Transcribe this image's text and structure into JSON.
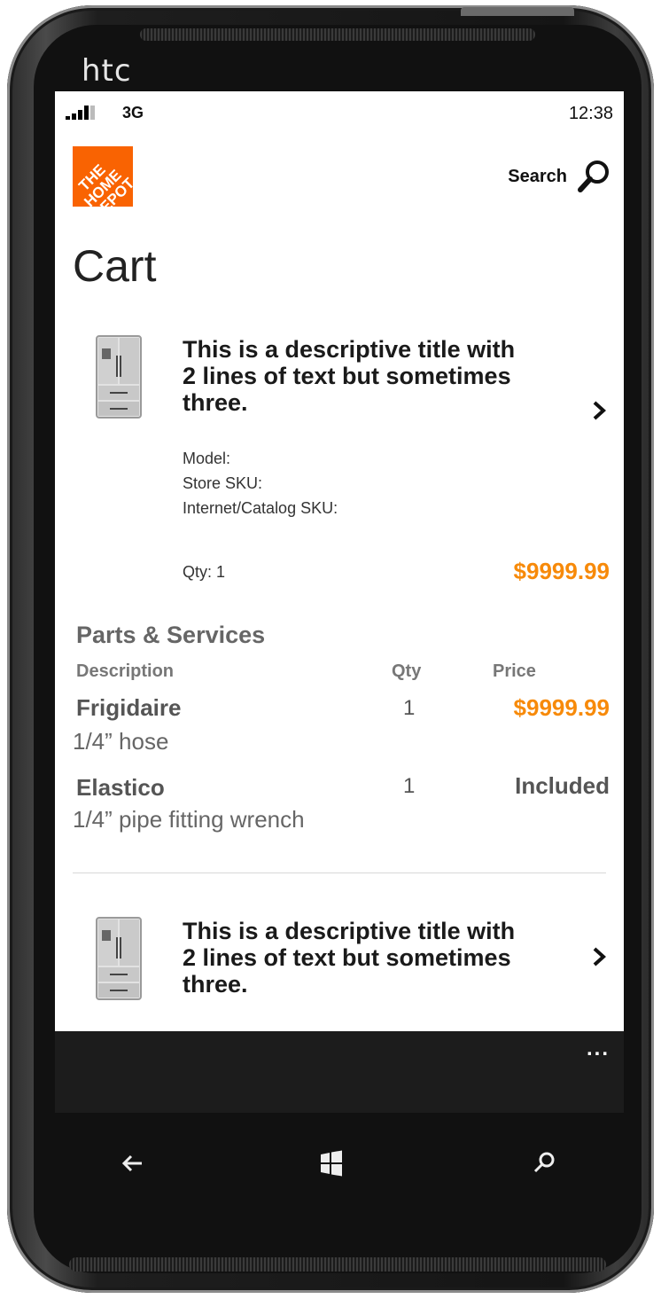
{
  "device": {
    "brand": "htc"
  },
  "status_bar": {
    "network": "3G",
    "time": "12:38"
  },
  "header": {
    "logo_text": "THE HOME DEPOT",
    "search_label": "Search"
  },
  "page": {
    "title": "Cart"
  },
  "cart_items": [
    {
      "title": "This is a descriptive title with 2 lines of text but sometimes three.",
      "model_label": "Model:",
      "store_sku_label": "Store SKU:",
      "internet_sku_label": "Internet/Catalog SKU:",
      "qty_label": "Qty: 1",
      "price": "$9999.99"
    },
    {
      "title": "This is a descriptive title with 2 lines of text but sometimes three."
    }
  ],
  "parts_services": {
    "title": "Parts & Services",
    "columns": [
      "Description",
      "Qty",
      "Price"
    ],
    "rows": [
      {
        "name": "Frigidaire",
        "description": "1/4” hose",
        "qty": "1",
        "price": "$9999.99"
      },
      {
        "name": "Elastico",
        "description": "1/4” pipe fitting wrench",
        "qty": "1",
        "price": "Included"
      }
    ]
  },
  "app_bar": {
    "more": "..."
  },
  "colors": {
    "brand_orange": "#f96302",
    "price_orange": "#f78a0a",
    "app_bar": "#1c1c1c"
  },
  "icons": [
    "signal-icon",
    "search-icon",
    "chevron-right-icon",
    "back-icon",
    "windows-icon",
    "search-hardware-icon",
    "product-thumbnail"
  ]
}
